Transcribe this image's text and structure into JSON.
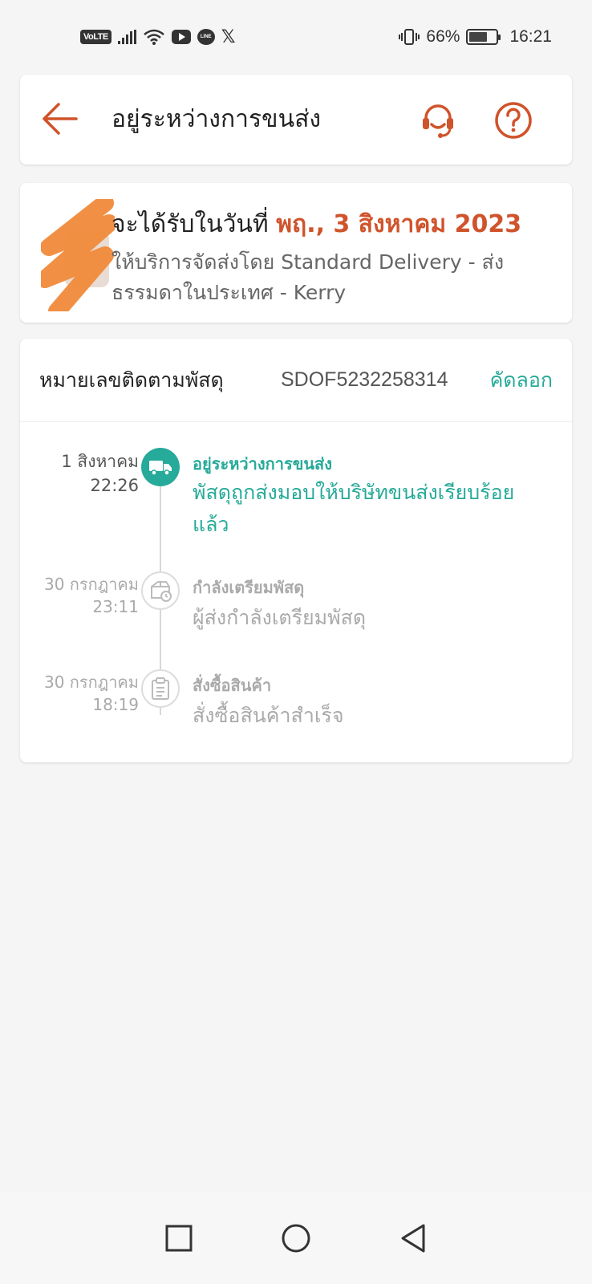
{
  "status_bar": {
    "volte": "VoLTE",
    "line_label": "LINE",
    "battery_percent": "66%",
    "battery_level": 0.66,
    "time": "16:21",
    "icons": [
      "signal-icon",
      "wifi-icon",
      "youtube-icon",
      "line-icon",
      "x-icon",
      "vibrate-icon",
      "battery-icon"
    ]
  },
  "header": {
    "title": "อยู่ระหว่างการขนส่ง",
    "accent_color": "#d0532b",
    "icons": [
      "back-arrow-icon",
      "headset-icon",
      "help-icon"
    ]
  },
  "delivery": {
    "eta_prefix": "จะได้รับในวันที่ ",
    "eta_date": "พฤ., 3 สิงหาคม 2023",
    "service": "ให้บริการจัดส่งโดย Standard Delivery - ส่งธรรมดาในประเทศ - Kerry"
  },
  "tracking": {
    "label": "หมายเลขติดตามพัสดุ",
    "number": "SDOF5232258314",
    "copy_label": "คัดลอก",
    "accent_color": "#26aa99"
  },
  "timeline": [
    {
      "date": "1 สิงหาคม",
      "time": "22:26",
      "title": "อยู่ระหว่างการขนส่ง",
      "description": "พัสดุถูกส่งมอบให้บริษัทขนส่งเรียบร้อยแล้ว",
      "icon": "truck-icon",
      "active": true
    },
    {
      "date": "30 กรกฎาคม",
      "time": "23:11",
      "title": "กำลังเตรียมพัสดุ",
      "description": " ผู้ส่งกำลังเตรียมพัสดุ",
      "icon": "package-clock-icon",
      "active": false
    },
    {
      "date": "30 กรกฎาคม",
      "time": "18:19",
      "title": "สั่งซื้อสินค้า",
      "description": "สั่งซื้อสินค้าสำเร็จ",
      "icon": "clipboard-icon",
      "active": false
    }
  ],
  "nav_bar": {
    "icons": [
      "recent-apps-icon",
      "home-icon",
      "back-icon"
    ]
  }
}
